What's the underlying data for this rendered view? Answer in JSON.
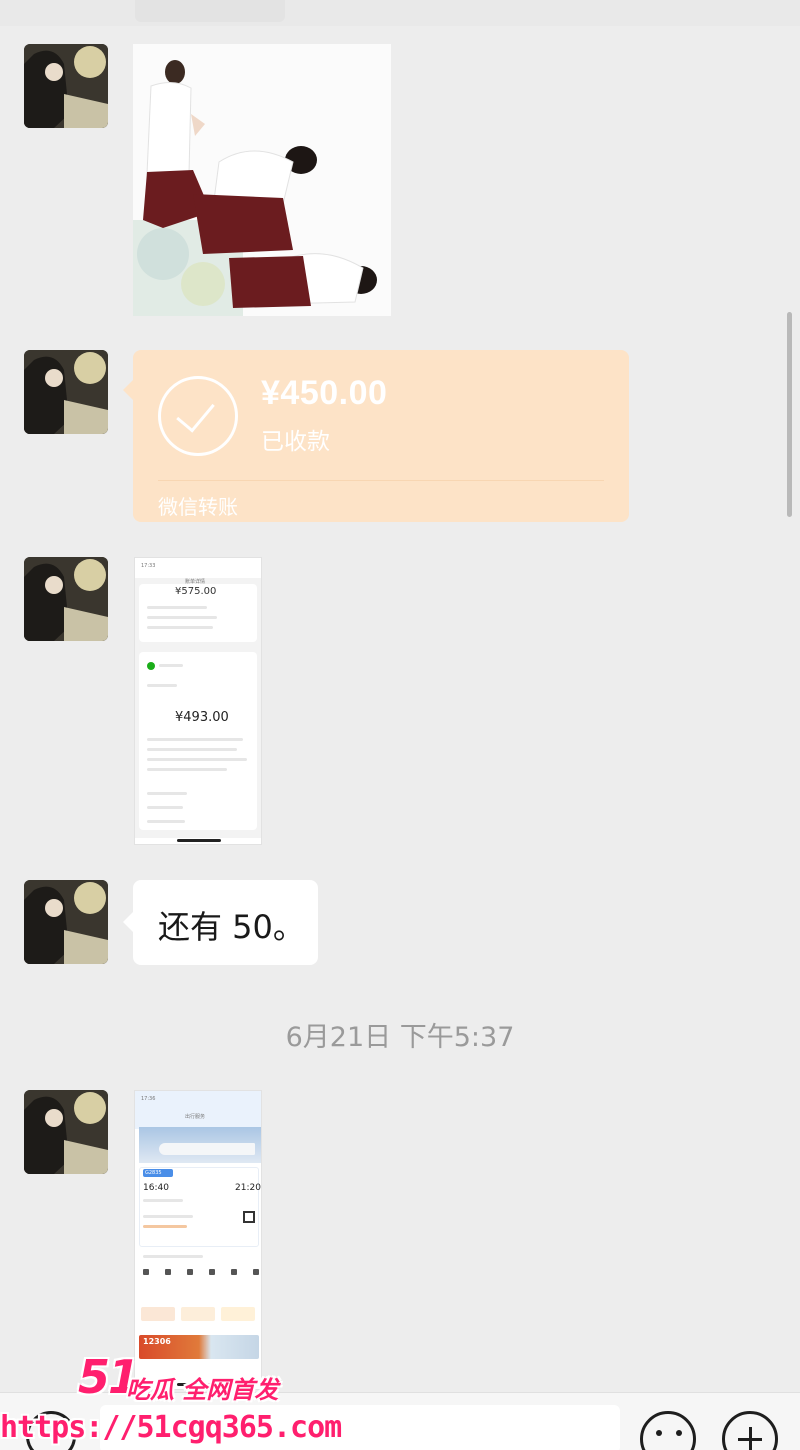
{
  "messages": {
    "transfer": {
      "amount": "¥450.00",
      "status": "已收款",
      "footer": "微信转账",
      "accent_color": "#fde3c7"
    },
    "screenshot_1": {
      "amount_top": "¥575.00",
      "amount_main": "¥493.00",
      "status_time": "17:33",
      "title": "账单详情"
    },
    "text_bubble": {
      "text": "还有 50。"
    },
    "screenshot_2": {
      "status_time": "17:36",
      "title": "出行服务",
      "train_no": "G2835",
      "depart_time": "16:40",
      "arrive_time": "21:20",
      "promo": "12306"
    }
  },
  "timestamp": "6月21日 下午5:37",
  "watermark": {
    "brand_number": "51",
    "slogan": "吃瓜 全网首发",
    "url": "https://51cgq365.com",
    "color": "#ff1f6e"
  },
  "icons": [
    "avatar",
    "check-circle-icon",
    "voice-icon",
    "emoji-icon",
    "plus-icon"
  ]
}
